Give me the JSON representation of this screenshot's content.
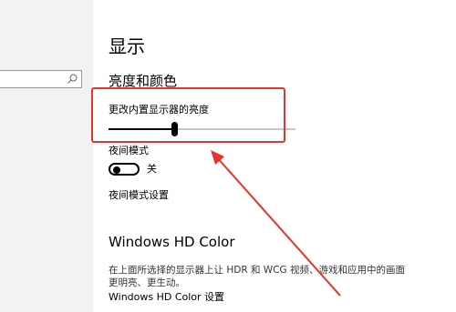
{
  "sidebar": {
    "search": {
      "value": "",
      "placeholder": "",
      "icon": "search-icon"
    }
  },
  "main": {
    "title": "显示",
    "section_title": "亮度和颜色",
    "brightness": {
      "label": "更改内置显示器的亮度",
      "value_fraction": 0.35
    },
    "night_mode": {
      "label": "夜间模式",
      "state": "关",
      "on": false
    },
    "night_mode_settings_link": "夜间模式设置",
    "hd_color": {
      "title": "Windows HD Color",
      "description": "在上面所选择的显示器上让 HDR 和 WCG 视频、游戏和应用中的画面更明亮、更生动。",
      "settings_link": "Windows HD Color 设置"
    }
  },
  "annotation": {
    "color": "#e8322a"
  },
  "colors": {
    "sidebar_bg": "#f2f2f2",
    "slider_fill": "#000000",
    "slider_rest": "#c6c6c6"
  }
}
